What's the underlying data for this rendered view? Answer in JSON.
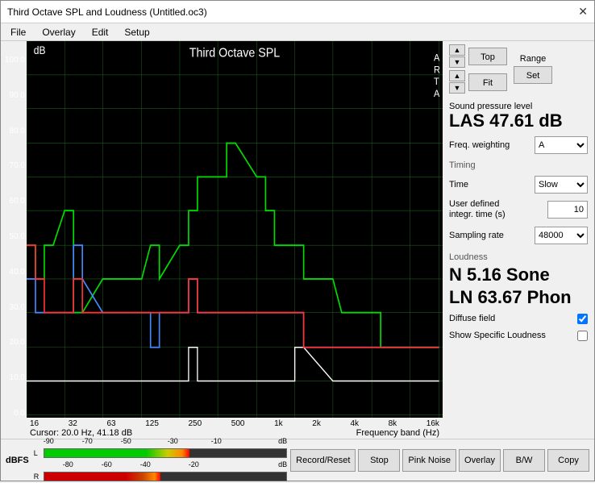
{
  "window": {
    "title": "Third Octave SPL and Loudness (Untitled.oc3)",
    "close_btn": "✕"
  },
  "menu": {
    "items": [
      "File",
      "Overlay",
      "Edit",
      "Setup"
    ]
  },
  "toolbar": {
    "top_label": "Top",
    "range_label": "Range",
    "fit_label": "Fit",
    "set_label": "Set",
    "up_arrow": "▲",
    "down_arrow": "▼"
  },
  "chart": {
    "title": "Third Octave SPL",
    "arta": "A\nR\nT\nA",
    "db_label": "dB",
    "y_ticks": [
      "100.0",
      "90.0",
      "80.0",
      "70.0",
      "60.0",
      "50.0",
      "40.0",
      "30.0",
      "20.0",
      "10.0",
      "0.0"
    ],
    "x_ticks": [
      "16",
      "32",
      "63",
      "125",
      "250",
      "500",
      "1k",
      "2k",
      "4k",
      "8k",
      "16k"
    ],
    "cursor_info": "Cursor:  20.0 Hz, 41.18 dB",
    "freq_band": "Frequency band (Hz)"
  },
  "spl": {
    "label": "Sound pressure level",
    "value": "LAS 47.61 dB",
    "freq_weighting_label": "Freq. weighting",
    "freq_weighting_value": "A"
  },
  "timing": {
    "label": "Timing",
    "time_label": "Time",
    "time_value": "Slow",
    "user_defined_label": "User defined\nintegr. time (s)",
    "user_defined_value": "10",
    "sampling_rate_label": "Sampling rate",
    "sampling_rate_value": "48000"
  },
  "loudness": {
    "label": "Loudness",
    "n_value": "N 5.16 Sone",
    "ln_value": "LN 63.67 Phon",
    "diffuse_field_label": "Diffuse field",
    "diffuse_field_checked": true,
    "show_specific_label": "Show Specific Loudness",
    "show_specific_checked": false
  },
  "bottom_buttons": {
    "record_reset": "Record/Reset",
    "stop": "Stop",
    "pink_noise": "Pink Noise",
    "overlay": "Overlay",
    "bw": "B/W",
    "copy": "Copy"
  },
  "meter": {
    "label": "dBFS",
    "scales": [
      "-90",
      "-70",
      "-50",
      "-30",
      "-10",
      "dB"
    ],
    "scales2": [
      "-80",
      "-60",
      "-40",
      "-20",
      "dB"
    ],
    "row1_label": "L",
    "row2_label": "R",
    "row1_fill": 60,
    "row2_fill": 50
  }
}
